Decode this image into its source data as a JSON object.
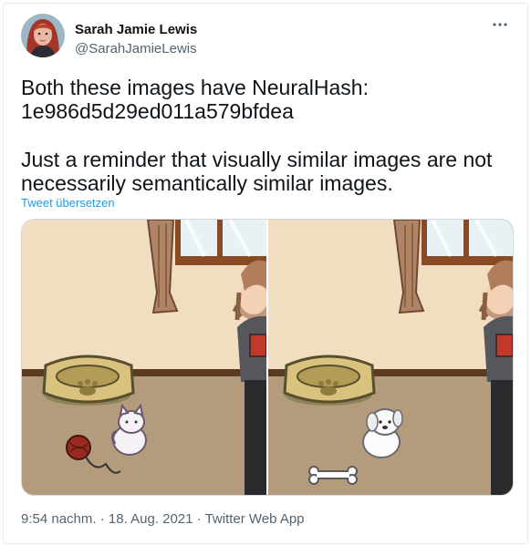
{
  "author": {
    "name": "Sarah Jamie Lewis",
    "handle": "@SarahJamieLewis",
    "avatar": "avatar-photo"
  },
  "more_icon": "more-icon",
  "tweet": {
    "line1": "Both these images have NeuralHash:",
    "line2": "1e986d5d29ed011a579bfdea",
    "line3": "Just a reminder that visually similar images are not",
    "line4": "necessarily semantically similar images.",
    "translate": "Tweet übersetzen"
  },
  "media": {
    "left_image": "cartoon room with dog bed, white kitten and red yarn ball",
    "right_image": "cartoon room with dog bed, white puppy and dog bone"
  },
  "meta": {
    "time": "9:54 nachm.",
    "separator": "·",
    "date": "18. Aug. 2021",
    "source": "Twitter Web App"
  },
  "colors": {
    "link": "#1d9bf0",
    "secondary_text": "#536471",
    "primary_text": "#0f1419",
    "border": "#cfd9de"
  }
}
